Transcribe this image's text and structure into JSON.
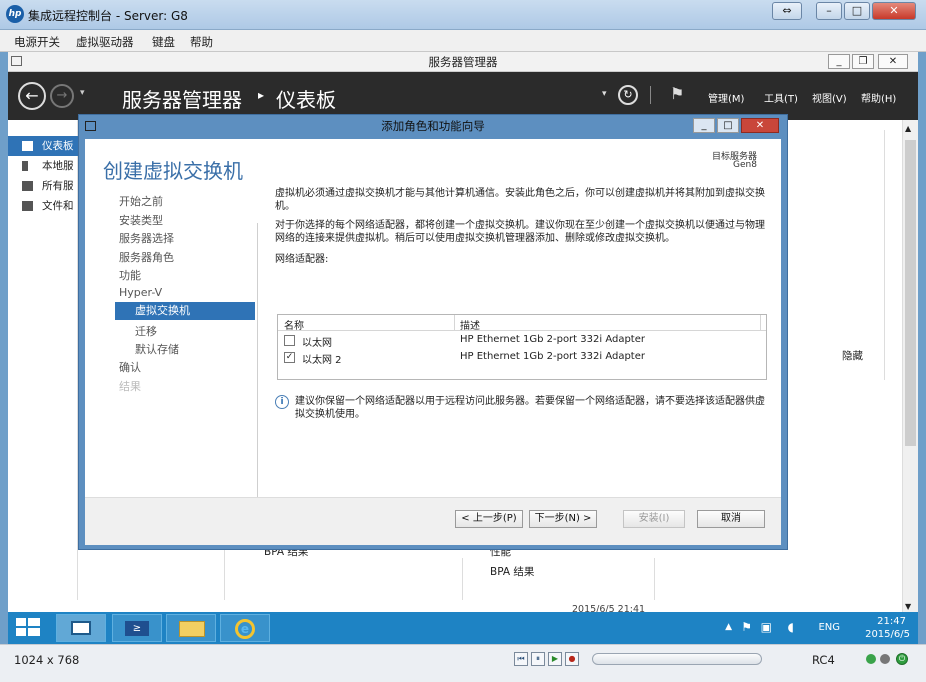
{
  "window": {
    "title": "集成远程控制台 - Server: G8",
    "logo": "hp"
  },
  "menu": [
    "电源开关",
    "虚拟驱动器",
    "键盘",
    "帮助"
  ],
  "server_manager": {
    "window_title": "服务器管理器",
    "breadcrumb_root": "服务器管理器",
    "breadcrumb_sep": "▸",
    "breadcrumb_page": "仪表板",
    "top_menu": [
      "管理(M)",
      "工具(T)",
      "视图(V)",
      "帮助(H)"
    ],
    "nav": [
      "仪表板",
      "本地服务器",
      "所有服务器",
      "文件和存储服务"
    ],
    "nav_visible": [
      "仪表板",
      "本地服",
      "所有服",
      "文件和"
    ],
    "bg_texts": {
      "hide": "隐藏",
      "bpa1": "BPA 结果",
      "perf": "性能",
      "bpa2": "BPA 结果",
      "timestamp": "2015/6/5 21:41"
    }
  },
  "wizard": {
    "title": "添加角色和功能向导",
    "heading": "创建虚拟交换机",
    "target_label": "目标服务器",
    "target_server": "Gen8",
    "steps": [
      {
        "label": "开始之前",
        "state": "normal"
      },
      {
        "label": "安装类型",
        "state": "normal"
      },
      {
        "label": "服务器选择",
        "state": "normal"
      },
      {
        "label": "服务器角色",
        "state": "normal"
      },
      {
        "label": "功能",
        "state": "normal"
      },
      {
        "label": "Hyper-V",
        "state": "normal"
      },
      {
        "label": "虚拟交换机",
        "state": "active"
      },
      {
        "label": "迁移",
        "state": "sub"
      },
      {
        "label": "默认存储",
        "state": "sub"
      },
      {
        "label": "确认",
        "state": "normal"
      },
      {
        "label": "结果",
        "state": "disabled"
      }
    ],
    "para1": "虚拟机必须通过虚拟交换机才能与其他计算机通信。安装此角色之后，你可以创建虚拟机并将其附加到虚拟交换机。",
    "para2": "对于你选择的每个网络适配器，都将创建一个虚拟交换机。建议你现在至少创建一个虚拟交换机以便通过与物理网络的连接来提供虚拟机。稍后可以使用虚拟交换机管理器添加、删除或修改虚拟交换机。",
    "adapters_label": "网络适配器:",
    "table_headers": [
      "名称",
      "描述"
    ],
    "rows": [
      {
        "checked": false,
        "name": "以太网",
        "desc": "HP Ethernet 1Gb 2-port 332i Adapter"
      },
      {
        "checked": true,
        "name": "以太网 2",
        "desc": "HP Ethernet 1Gb 2-port 332i Adapter"
      }
    ],
    "info": "建议你保留一个网络适配器以用于远程访问此服务器。若要保留一个网络适配器，请不要选择该适配器供虚拟交换机使用。",
    "buttons": {
      "prev": "< 上一步(P)",
      "next": "下一步(N) >",
      "install": "安装(I)",
      "cancel": "取消"
    }
  },
  "taskbar": {
    "lang": "ENG",
    "time": "21:47",
    "date": "2015/6/5"
  },
  "status": {
    "resolution": "1024 x 768",
    "right": "RC4"
  },
  "colors": {
    "accent": "#2f73b6",
    "taskbar": "#1e83c4",
    "dialog_frame": "#5d8fc0"
  }
}
